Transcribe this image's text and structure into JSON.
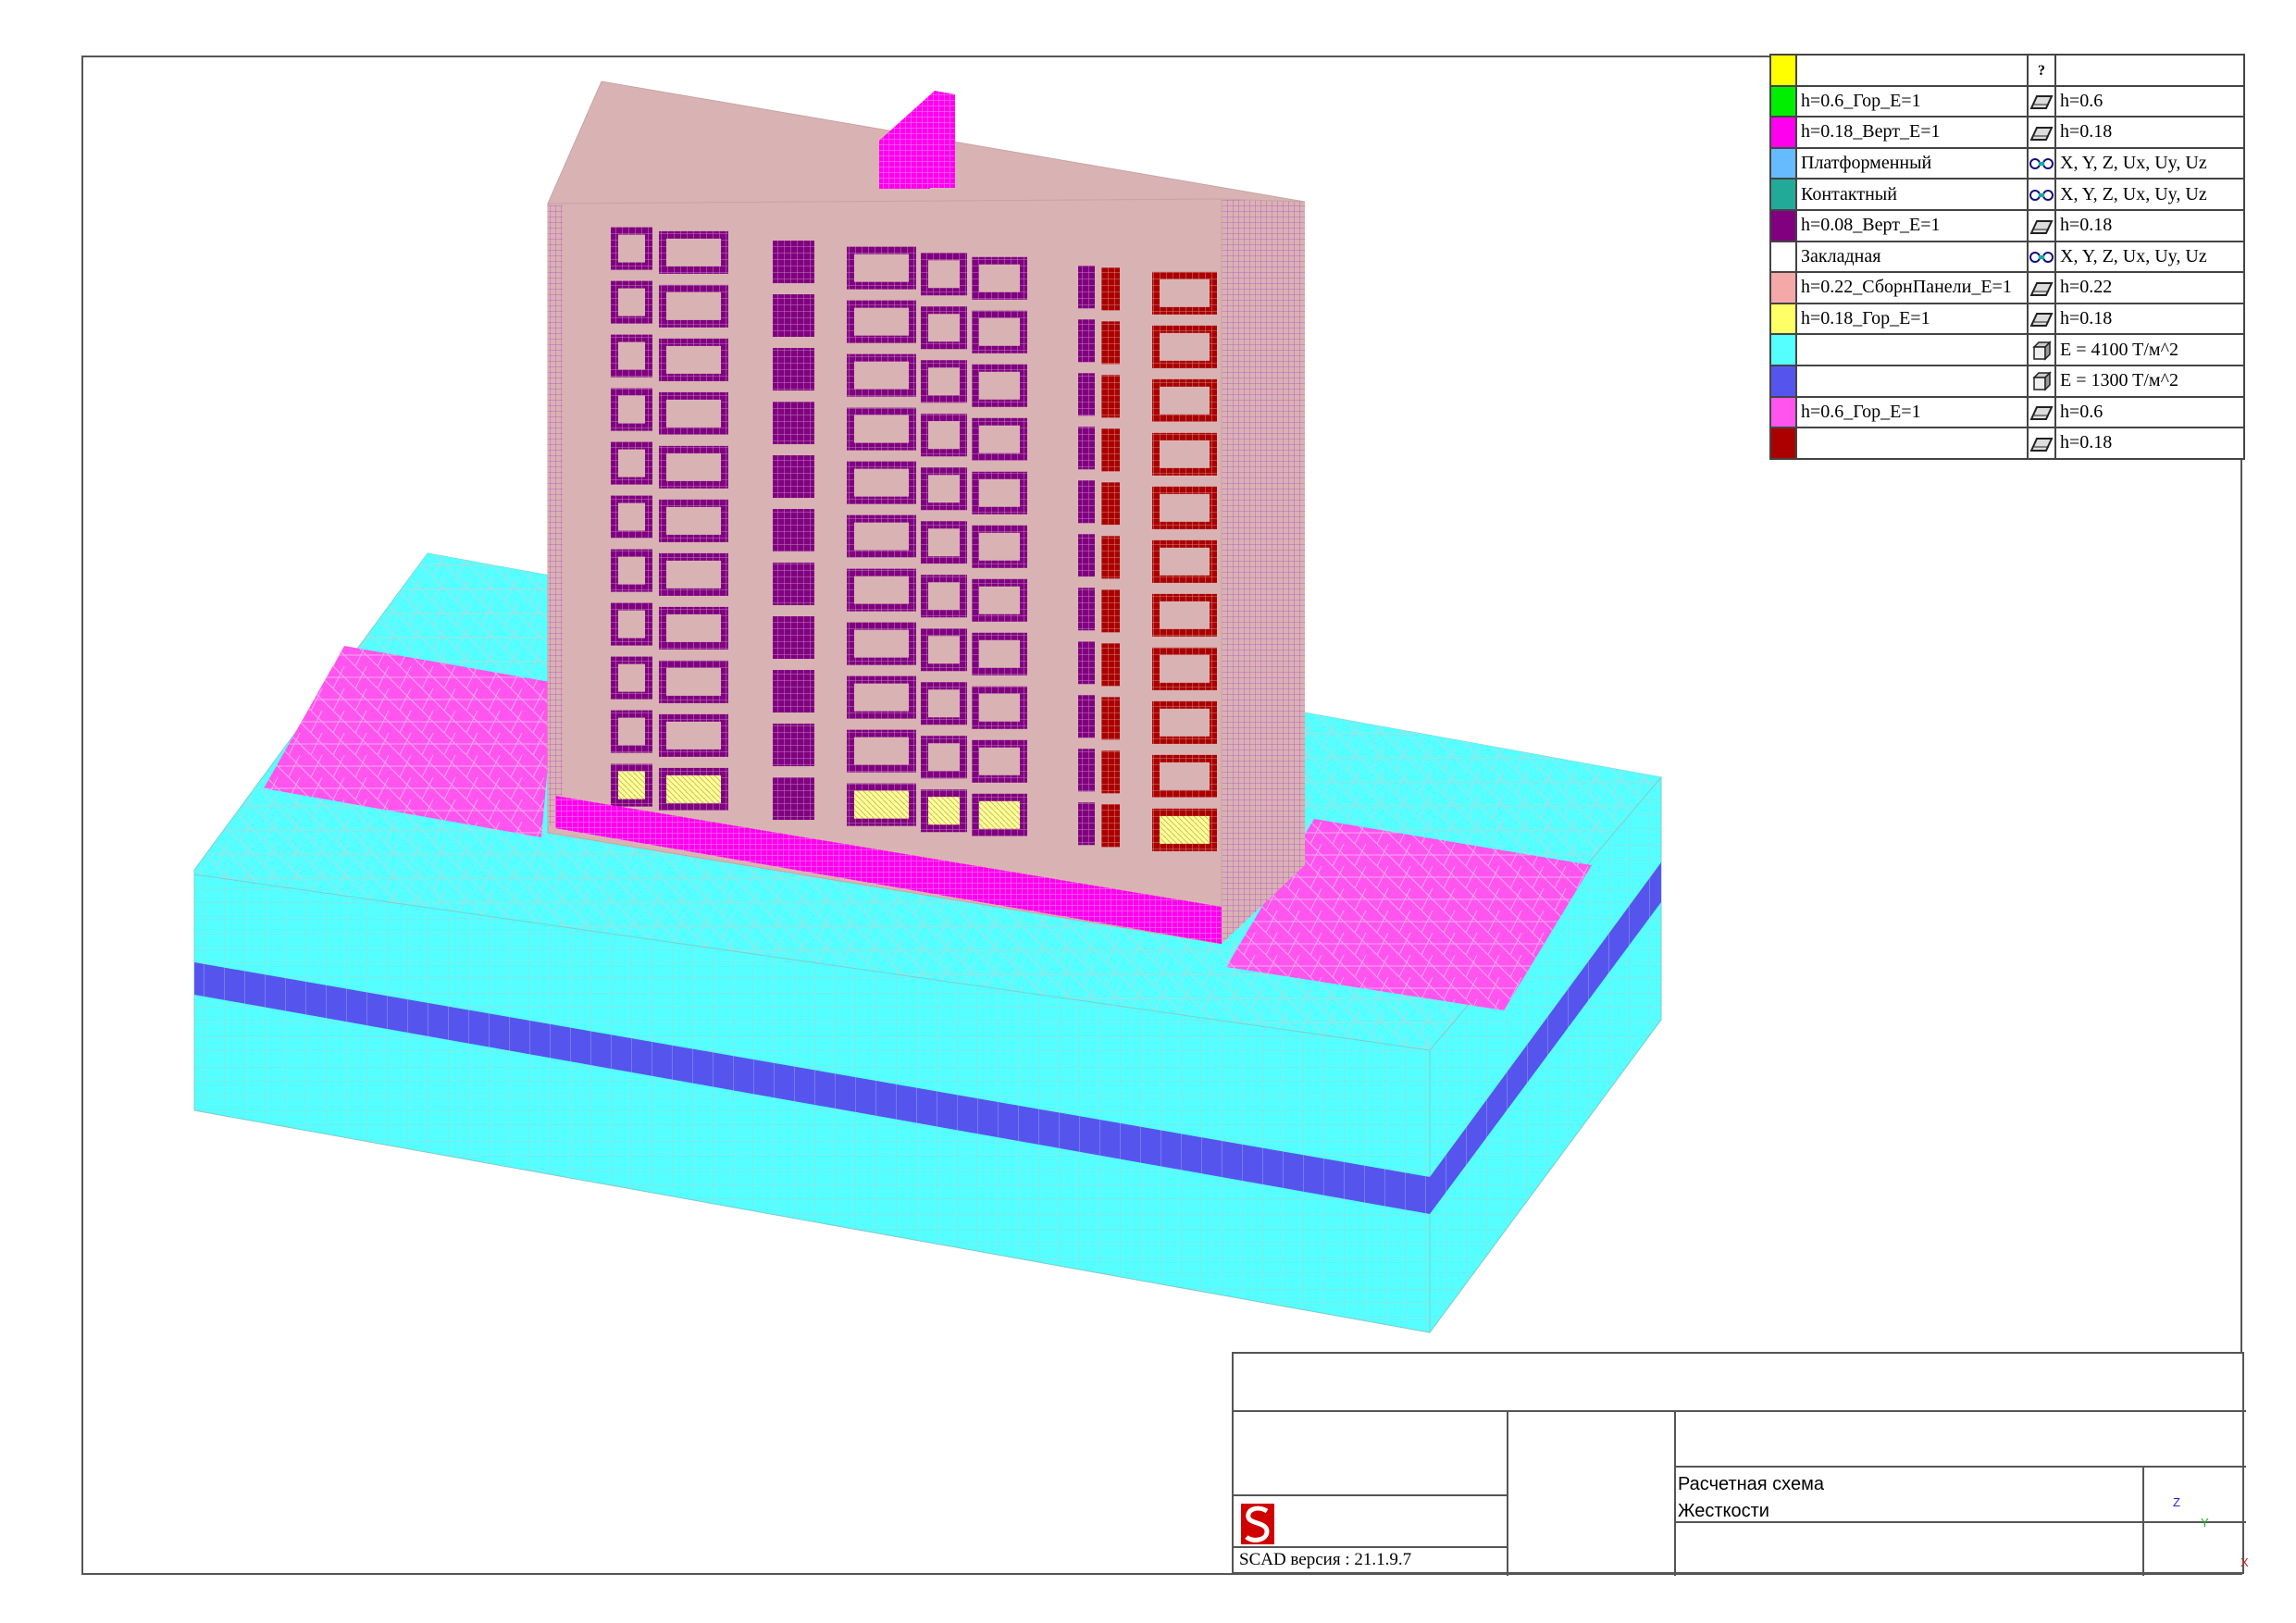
{
  "legend": [
    {
      "color": "#ffff00",
      "name": "",
      "icon": "question-icon",
      "icon_text": "?",
      "value": ""
    },
    {
      "color": "#00ee00",
      "name": "h=0.6_Гор_E=1",
      "icon": "plate-icon",
      "value": "h=0.6"
    },
    {
      "color": "#ff00ee",
      "name": "h=0.18_Верт_E=1",
      "icon": "plate-icon",
      "value": "h=0.18"
    },
    {
      "color": "#66bbff",
      "name": "Платформенный",
      "icon": "joint-icon",
      "value": "X, Y, Z, Ux, Uy, Uz"
    },
    {
      "color": "#22aa99",
      "name": "Контактный",
      "icon": "joint-icon",
      "value": "X, Y, Z, Ux, Uy, Uz"
    },
    {
      "color": "#800080",
      "name": "h=0.08_Верт_E=1",
      "icon": "plate-icon",
      "value": "h=0.18"
    },
    {
      "color": "#ffffff",
      "name": "Закладная",
      "icon": "joint-icon",
      "value": "X, Y, Z, Ux, Uy, Uz"
    },
    {
      "color": "#f4a8a8",
      "name": "h=0.22_СборнПанели_E=1",
      "icon": "plate-icon",
      "value": "h=0.22"
    },
    {
      "color": "#ffff66",
      "name": "h=0.18_Гор_E=1",
      "icon": "plate-icon",
      "value": "h=0.18"
    },
    {
      "color": "#55ffff",
      "name": "",
      "icon": "solid-icon",
      "value": "E = 4100 T/м^2"
    },
    {
      "color": "#5555ee",
      "name": "",
      "icon": "solid-icon",
      "value": "E = 1300 T/м^2"
    },
    {
      "color": "#ff55ee",
      "name": "h=0.6_Гор_E=1",
      "icon": "plate-icon",
      "value": "h=0.6"
    },
    {
      "color": "#aa0000",
      "name": "",
      "icon": "plate-icon",
      "value": "h=0.18"
    }
  ],
  "title_block": {
    "scheme_label": "Расчетная схема",
    "mode_label": "Жесткости",
    "version_text": "SCAD версия : 21.1.9.7",
    "axes": {
      "z": "Z",
      "y": "Y",
      "x": "X"
    }
  },
  "colors": {
    "soil_light": "#55ffff",
    "soil_dark": "#5555ee",
    "slab_magenta": "#ff55ee",
    "building_pink": "#d9b3b3",
    "window_purple": "#800080",
    "window_red": "#aa0000",
    "floor_yellow": "#ffff66",
    "logo_red": "#d00000"
  }
}
